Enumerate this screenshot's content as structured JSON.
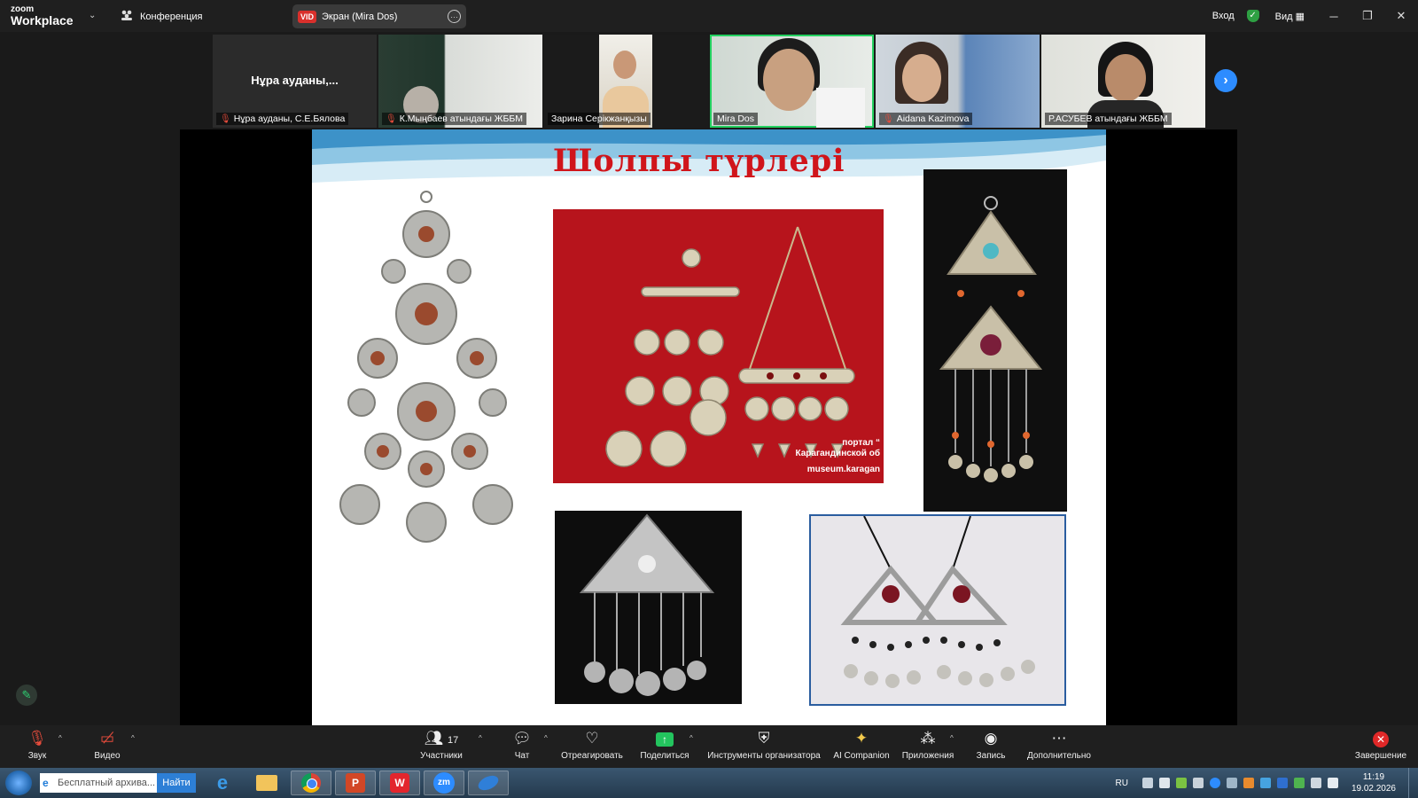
{
  "app": {
    "logo_line1": "zoom",
    "logo_line2": "Workplace"
  },
  "topbar": {
    "conference_label": "Конференция",
    "screen_share_badge": "VID",
    "screen_share_label": "Экран (Mira Dos)",
    "signin_label": "Вход",
    "view_label": "Вид",
    "minimize": "─",
    "restore": "❐",
    "close": "✕"
  },
  "participants": [
    {
      "title": "Нұра ауданы,...",
      "name": "Нұра ауданы,   С.Е.Бялова",
      "muted": true,
      "active": false
    },
    {
      "name": "К.Мыңбаев атындағы ЖББМ",
      "muted": true,
      "active": false
    },
    {
      "name": "Зарина Серікжанқызы",
      "muted": false,
      "active": false
    },
    {
      "name": "Mira Dos",
      "muted": false,
      "active": true
    },
    {
      "name": "Aidana Kazimova",
      "muted": true,
      "active": false
    },
    {
      "name": "Р.АСУБЕВ атындағы ЖББМ",
      "muted": false,
      "active": false
    }
  ],
  "slide": {
    "title": "Шолпы түрлері",
    "watermark_lines": [
      "портал “",
      "Карагандинской об",
      "museum.karagan"
    ]
  },
  "toolbar": {
    "audio": "Звук",
    "video": "Видео",
    "participants": "Участники",
    "participants_count": "17",
    "chat": "Чат",
    "react": "Отреагировать",
    "share": "Поделиться",
    "host_tools": "Инструменты организатора",
    "ai_companion": "AI Companion",
    "apps": "Приложения",
    "record": "Запись",
    "more": "Дополнительно",
    "end": "Завершение"
  },
  "taskbar": {
    "search_placeholder": "Бесплатный архива...",
    "find_button": "Найти",
    "language": "RU",
    "time": "11:19",
    "date": "19.02.2026"
  },
  "colors": {
    "accent": "#2d8cff",
    "active_speaker": "#23d160",
    "title_red": "#d0151b"
  }
}
